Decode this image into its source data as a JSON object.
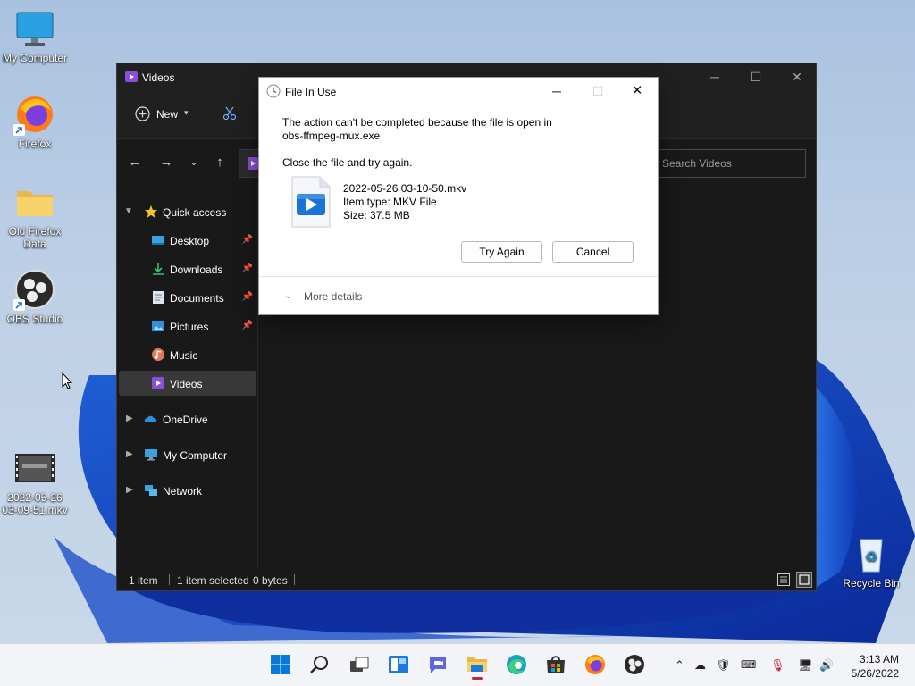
{
  "desktop": {
    "icons": [
      {
        "label": "My Computer"
      },
      {
        "label": "Firefox"
      },
      {
        "label": "Old Firefox Data"
      },
      {
        "label": "OBS Studio"
      },
      {
        "label": "2022-05-26 03-09-51.mkv"
      },
      {
        "label": "Recycle Bin"
      }
    ]
  },
  "explorer": {
    "title": "Videos",
    "toolbar": {
      "new_label": "New"
    },
    "search_placeholder": "Search Videos",
    "nav": {
      "quick_access": "Quick access",
      "desktop": "Desktop",
      "downloads": "Downloads",
      "documents": "Documents",
      "pictures": "Pictures",
      "music": "Music",
      "videos": "Videos",
      "onedrive": "OneDrive",
      "my_computer": "My Computer",
      "network": "Network"
    },
    "status": {
      "count": "1 item",
      "selected": "1 item selected",
      "size": "0 bytes"
    }
  },
  "dialog": {
    "title": "File In Use",
    "message_line1": "The action can't be completed because the file is open in",
    "message_line2": "obs-ffmpeg-mux.exe",
    "instruction": "Close the file and try again.",
    "file_name": "2022-05-26 03-10-50.mkv",
    "file_type": "Item type: MKV File",
    "file_size": "Size: 37.5 MB",
    "try_again_label": "Try Again",
    "cancel_label": "Cancel",
    "more_details_label": "More details"
  },
  "taskbar": {
    "time": "3:13 AM",
    "date": "5/26/2022"
  },
  "colors": {
    "accent": "#0067c0",
    "explorer_bg": "#191919",
    "dialog_bg": "#ffffff",
    "taskbar_bg": "#f2f4f8"
  }
}
